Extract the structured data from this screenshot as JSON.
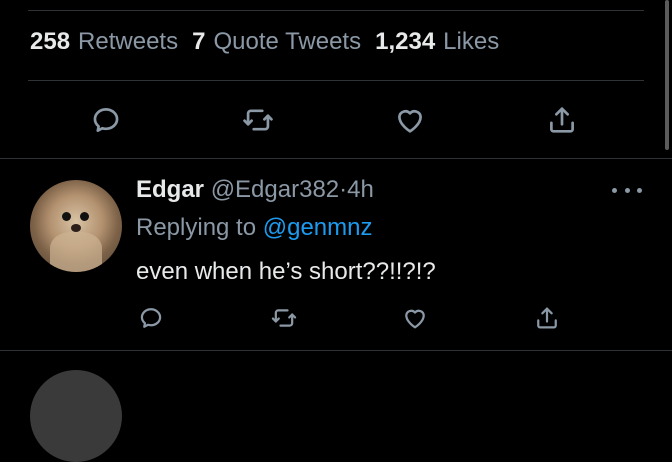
{
  "stats": {
    "retweets_count": "258",
    "retweets_label": "Retweets",
    "quotes_count": "7",
    "quotes_label": "Quote Tweets",
    "likes_count": "1,234",
    "likes_label": "Likes"
  },
  "tweet_actions": {
    "icons": [
      "reply-icon",
      "retweet-icon",
      "like-icon",
      "share-icon"
    ]
  },
  "reply": {
    "name": "Edgar",
    "handle": "@Edgar382",
    "separator": "·",
    "time": "4h",
    "replying_prefix": "Replying to",
    "replying_handle": "@genmnz",
    "text": "even when he’s short??!!?!?"
  },
  "colors": {
    "background": "#000000",
    "primary_text": "#e7e9ea",
    "secondary_text": "#8b98a5",
    "link": "#1d9bf0",
    "divider": "#2f3336"
  }
}
